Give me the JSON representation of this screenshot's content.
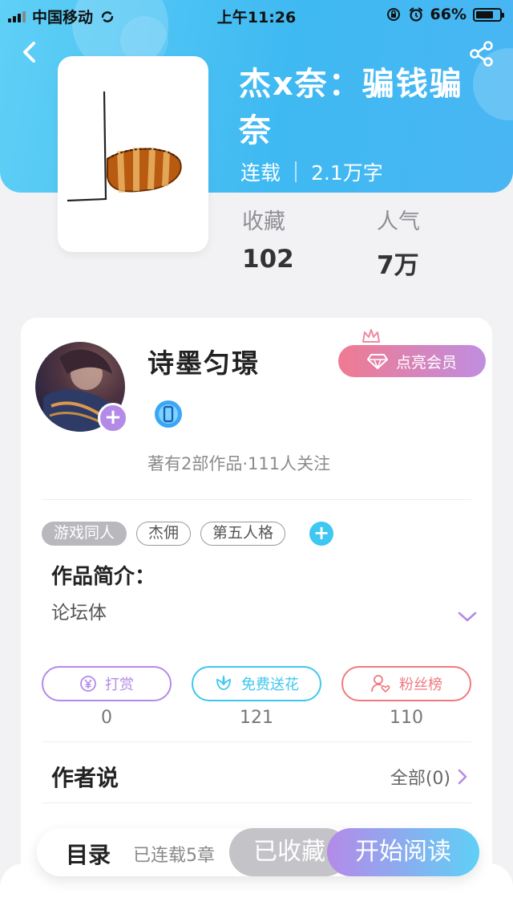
{
  "status_bar": {
    "carrier": "中国移动",
    "time": "上午11:26",
    "battery": "66%"
  },
  "book": {
    "title": "杰x奈：骗钱骗奈",
    "status": "连载",
    "word_count": "2.1万字",
    "stats": [
      {
        "label": "收藏",
        "value": "102"
      },
      {
        "label": "人气",
        "value": "7万"
      }
    ]
  },
  "author": {
    "name": "诗墨匀璟",
    "vip_button": "点亮会员",
    "summary": "著有2部作品·111人关注"
  },
  "tags": [
    "游戏同人",
    "杰佣",
    "第五人格"
  ],
  "intro": {
    "title": "作品简介：",
    "text": "论坛体"
  },
  "actions": [
    {
      "label": "打赏",
      "count": "0",
      "color": "#b48ae8"
    },
    {
      "label": "免费送花",
      "count": "121",
      "color": "#3ec7f0"
    },
    {
      "label": "粉丝榜",
      "count": "110",
      "color": "#f07a80"
    }
  ],
  "author_says": {
    "title": "作者说",
    "more": "全部(0)"
  },
  "bottom_bar": {
    "catalog": "目录",
    "chapters": "已连载5章",
    "collected": "已收藏",
    "read": "开始阅读"
  }
}
